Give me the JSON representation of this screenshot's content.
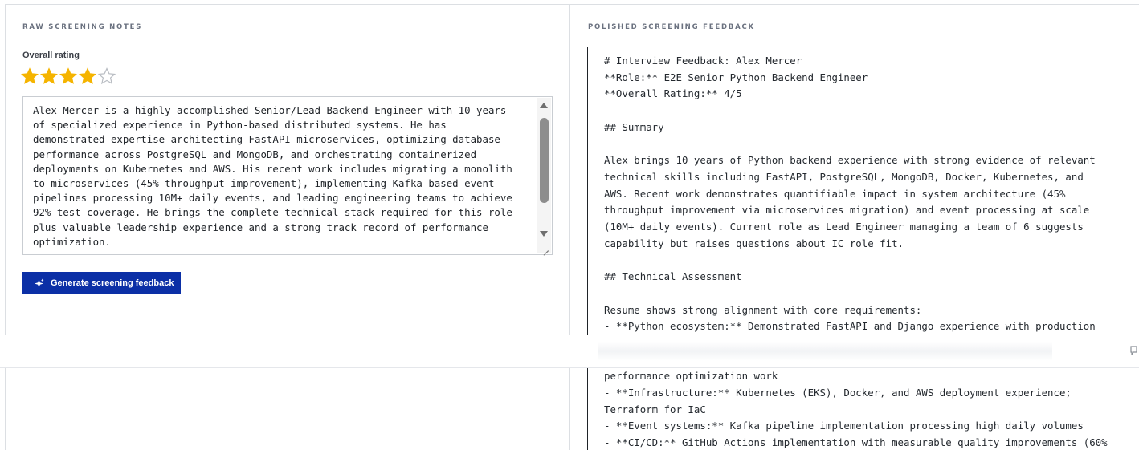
{
  "left_panel": {
    "heading": "RAW SCREENING NOTES",
    "rating": {
      "label": "Overall rating",
      "value": 4,
      "max": 5,
      "filled_color": "#f5b400",
      "empty_color": "#b8bcc2"
    },
    "notes_text": "Alex Mercer is a highly accomplished Senior/Lead Backend Engineer with 10 years\nof specialized experience in Python-based distributed systems. He has\ndemonstrated expertise architecting FastAPI microservices, optimizing database\nperformance across PostgreSQL and MongoDB, and orchestrating containerized\ndeployments on Kubernetes and AWS. His recent work includes migrating a monolith\nto microservices (45% throughput improvement), implementing Kafka-based event\npipelines processing 10M+ daily events, and leading engineering teams to achieve\n92% test coverage. He brings the complete technical stack required for this role\nplus valuable leadership experience and a strong track record of performance\noptimization.",
    "generate_button": {
      "label": "Generate screening feedback",
      "icon": "sparkle-icon",
      "color": "#0b2fa6"
    }
  },
  "right_panel": {
    "heading": "POLISHED SCREENING FEEDBACK",
    "feedback_text": "# Interview Feedback: Alex Mercer\n**Role:** E2E Senior Python Backend Engineer\n**Overall Rating:** 4/5\n\n## Summary\n\nAlex brings 10 years of Python backend experience with strong evidence of relevant\ntechnical skills including FastAPI, PostgreSQL, MongoDB, Docker, Kubernetes, and\nAWS. Recent work demonstrates quantifiable impact in system architecture (45%\nthroughput improvement via microservices migration) and event processing at scale\n(10M+ daily events). Current role as Lead Engineer managing a team of 6 suggests\ncapability but raises questions about IC role fit.\n\n## Technical Assessment\n\nResume shows strong alignment with core requirements:\n- **Python ecosystem:** Demonstrated FastAPI and Django experience with production\n\n\nperformance optimization work\n- **Infrastructure:** Kubernetes (EKS), Docker, and AWS deployment experience;\nTerraform for IaC\n- **Event systems:** Kafka pipeline implementation processing high daily volumes\n- **CI/CD:** GitHub Actions implementation with measurable quality improvements (60%"
  }
}
